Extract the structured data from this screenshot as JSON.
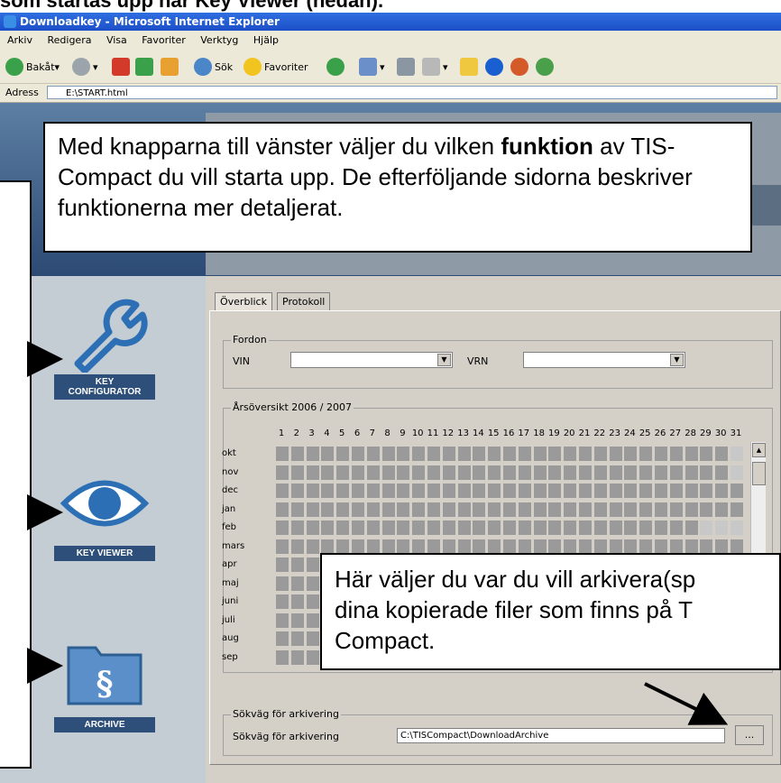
{
  "document_heading": "som startas upp när Key Viewer (nedan).",
  "window": {
    "title": "Downloadkey - Microsoft Internet Explorer"
  },
  "menubar": [
    "Arkiv",
    "Redigera",
    "Visa",
    "Favoriter",
    "Verktyg",
    "Hjälp"
  ],
  "toolbar": {
    "back_label": "Bakåt",
    "search_label": "Sök",
    "favorites_label": "Favoriter"
  },
  "address": {
    "label": "Adress",
    "value": "E:\\START.html"
  },
  "callout_top": {
    "text_before": "Med knapparna till vänster väljer du vilken ",
    "bold": "funktion",
    "text_after": " av TIS-Compact du vill starta upp. De efterföljande sidorna beskriver funktionerna mer detaljerat."
  },
  "callout_bottom": {
    "line1": "Här väljer du var du vill arkivera(sp",
    "line2": "dina kopierade filer som finns på T",
    "line3": "Compact."
  },
  "left_menu": [
    {
      "label_line1": "KEY",
      "label_line2": "CONFIGURATOR",
      "icon": "wrench-icon"
    },
    {
      "label_line1": "KEY VIEWER",
      "label_line2": "",
      "icon": "eye-icon"
    },
    {
      "label_line1": "ARCHIVE",
      "label_line2": "",
      "icon": "folder-icon"
    }
  ],
  "tabs": [
    "Överblick",
    "Protokoll"
  ],
  "fordon": {
    "title": "Fordon",
    "vin_label": "VIN",
    "vrn_label": "VRN"
  },
  "overview": {
    "title": "Årsöversikt 2006 / 2007",
    "days": [
      "1",
      "2",
      "3",
      "4",
      "5",
      "6",
      "7",
      "8",
      "9",
      "10",
      "11",
      "12",
      "13",
      "14",
      "15",
      "16",
      "17",
      "18",
      "19",
      "20",
      "21",
      "22",
      "23",
      "24",
      "25",
      "26",
      "27",
      "28",
      "29",
      "30",
      "31"
    ],
    "months": [
      "okt",
      "nov",
      "dec",
      "jan",
      "feb",
      "mars",
      "apr",
      "maj",
      "juni",
      "juli",
      "aug",
      "sep"
    ]
  },
  "archive_path": {
    "group_title": "Sökväg för arkivering",
    "label": "Sökväg för arkivering",
    "value": "C:\\TISCompact\\DownloadArchive",
    "browse_label": "..."
  },
  "colors": {
    "titlebar": "#1c4fc8",
    "menu_label_bg": "#2d4f79",
    "panel": "#d4d0c8",
    "cell": "#9a9a9a"
  }
}
